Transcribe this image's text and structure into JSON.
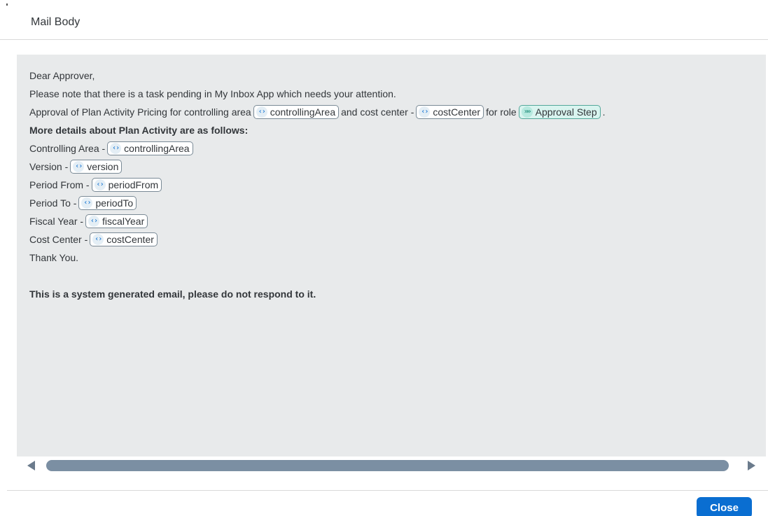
{
  "dialog": {
    "title": "Mail Body",
    "close_label": "Close"
  },
  "mail": {
    "greeting": "Dear Approver,",
    "intro": "Please note that there is a task pending in My Inbox App which needs your attention.",
    "approval_text_1": "Approval of Plan Activity Pricing for controlling area",
    "approval_token_1": "controllingArea",
    "approval_text_2": "and cost center -",
    "approval_token_2": "costCenter",
    "approval_text_3": "for role",
    "approval_role_token": "Approval Step",
    "approval_text_end": ".",
    "details_heading": "More details about Plan Activity are as follows:",
    "fields": [
      {
        "label": "Controlling Area -",
        "token": "controllingArea"
      },
      {
        "label": "Version -",
        "token": "version"
      },
      {
        "label": "Period From -",
        "token": "periodFrom"
      },
      {
        "label": "Period To -",
        "token": "periodTo"
      },
      {
        "label": "Fiscal Year -",
        "token": "fiscalYear"
      },
      {
        "label": "Cost Center -",
        "token": "costCenter"
      }
    ],
    "thanks": "Thank You.",
    "disclaimer": "This is a system generated email, please do not respond to it."
  },
  "icons": {
    "variable": "‹›",
    "role": "»»"
  },
  "colors": {
    "accent": "#0a6ed1",
    "pane_background": "#e8eaeb",
    "scroll_thumb": "#7b8fa3",
    "role_token": "#d9f4ef"
  }
}
